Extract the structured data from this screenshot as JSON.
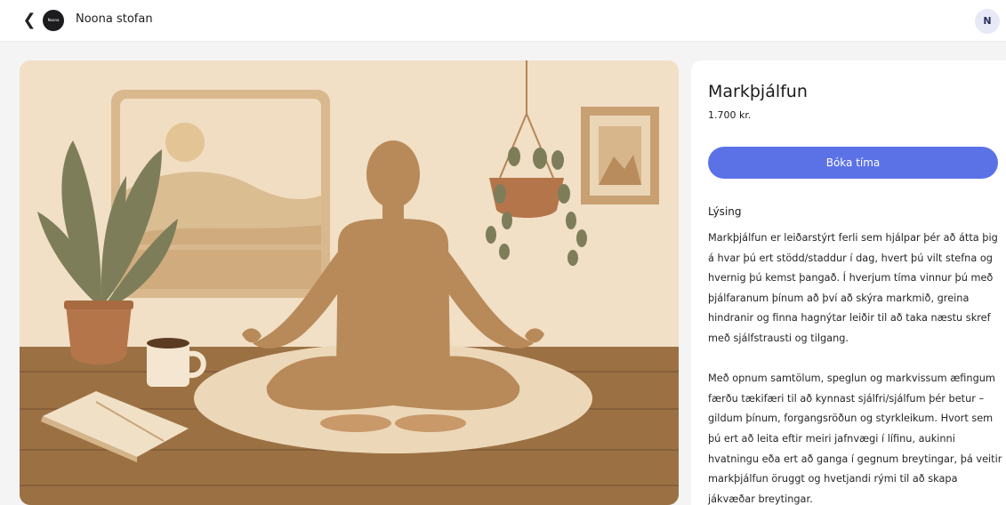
{
  "header": {
    "back_icon": "chevron-left-icon",
    "logo_text": "Noona stofan",
    "brand_name": "Noona stofan",
    "avatar_initial": "N"
  },
  "service": {
    "title": "Markþjálfun",
    "price": "1.700 kr.",
    "book_label": "Bóka tíma",
    "description_heading": "Lýsing",
    "description_paragraphs": [
      "Markþjálfun er leiðarstýrt ferli sem hjálpar þér að átta þig á hvar þú ert stödd/staddur í dag, hvert þú vilt stefna og hvernig þú kemst þangað. Í hverjum tíma vinnur þú með þjálfaranum þínum að því að skýra markmið, greina hindranir og finna hagnýtar leiðir til að taka næstu skref með sjálfstrausti og tilgang.",
      "Með opnum samtölum, speglun og markvissum æfingum færðu tækifæri til að kynnast sjálfri/sjálfum þér betur – gildum þínum, forgangsröðun og styrkleikum. Hvort sem þú ert að leita eftir meiri jafnvægi í lífinu, aukinni hvatningu eða ert að ganga í gegnum breytingar, þá veitir markþjálfun öruggt og hvetjandi rými til að skapa jákvæðar breytingar."
    ]
  },
  "colors": {
    "accent": "#5b72e7",
    "hero_bg": "#f1dfc6",
    "floor": "#9b7144"
  }
}
